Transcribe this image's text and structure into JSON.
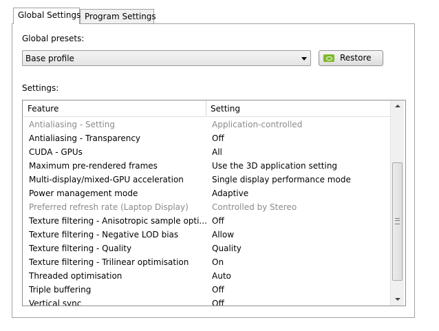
{
  "tabs": [
    {
      "label": "Global Settings",
      "active": true
    },
    {
      "label": "Program Settings",
      "active": false
    }
  ],
  "presets": {
    "label": "Global presets:",
    "selected": "Base profile",
    "restore_label": "Restore"
  },
  "settings": {
    "label": "Settings:",
    "columns": [
      "Feature",
      "Setting"
    ],
    "rows": [
      {
        "feature": "Antialiasing - Setting",
        "setting": "Application-controlled",
        "disabled": true
      },
      {
        "feature": "Antialiasing - Transparency",
        "setting": "Off",
        "disabled": false
      },
      {
        "feature": "CUDA - GPUs",
        "setting": "All",
        "disabled": false
      },
      {
        "feature": "Maximum pre-rendered frames",
        "setting": "Use the 3D application setting",
        "disabled": false
      },
      {
        "feature": "Multi-display/mixed-GPU acceleration",
        "setting": "Single display performance mode",
        "disabled": false
      },
      {
        "feature": "Power management mode",
        "setting": "Adaptive",
        "disabled": false
      },
      {
        "feature": "Preferred refresh rate (Laptop Display)",
        "setting": "Controlled by Stereo",
        "disabled": true
      },
      {
        "feature": "Texture filtering - Anisotropic sample opti...",
        "setting": "Off",
        "disabled": false
      },
      {
        "feature": "Texture filtering - Negative LOD bias",
        "setting": "Allow",
        "disabled": false
      },
      {
        "feature": "Texture filtering - Quality",
        "setting": "Quality",
        "disabled": false
      },
      {
        "feature": "Texture filtering - Trilinear optimisation",
        "setting": "On",
        "disabled": false
      },
      {
        "feature": "Threaded optimisation",
        "setting": "Auto",
        "disabled": false
      },
      {
        "feature": "Triple buffering",
        "setting": "Off",
        "disabled": false
      },
      {
        "feature": "Vertical sync",
        "setting": "Off",
        "disabled": false
      }
    ]
  },
  "icons": {
    "restore": "nvidia-logo-icon",
    "dropdown": "chevron-down-icon",
    "scroll_up": "arrow-up-icon",
    "scroll_down": "arrow-down-icon"
  },
  "colors": {
    "nvidia_green": "#7fb82c",
    "disabled_text": "#8a8a8a"
  }
}
